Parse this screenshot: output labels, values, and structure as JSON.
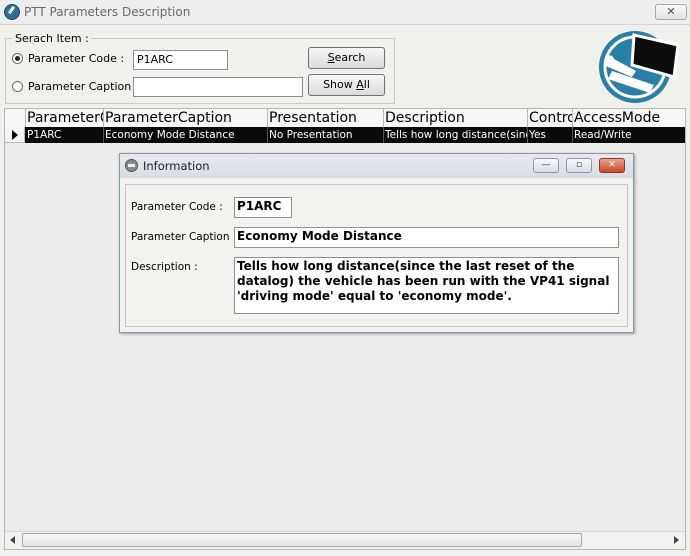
{
  "window": {
    "title": "PTT Parameters Description",
    "close_glyph": "✕"
  },
  "search": {
    "legend": "Serach Item :",
    "param_code_label": "Parameter Code :",
    "param_code_value": "P1ARC",
    "param_caption_label": "Parameter Caption  :",
    "param_caption_value": "",
    "selected_option": "Parameter Code",
    "search_button_hotkey": "S",
    "search_button_rest": "earch",
    "showall_button_prefix": "Show ",
    "showall_button_hotkey": "A",
    "showall_button_rest": "ll"
  },
  "logo": {
    "icon": "wrench-laptop-icon",
    "color": "#2a7fa6"
  },
  "grid": {
    "columns": [
      "ParameterCode",
      "ParameterCaption",
      "Presentation",
      "Description",
      "Control",
      "AccessMode"
    ],
    "rows": [
      [
        "P1ARC",
        "Economy Mode Distance",
        "No Presentation",
        "Tells how long distance(since the last reset of the datalog)",
        "Yes",
        "Read/Write"
      ]
    ],
    "selected_row_color": "#0a0a0a"
  },
  "dialog": {
    "title": "Information",
    "code_label": "Parameter Code :",
    "code_value": "P1ARC",
    "caption_label": "Parameter Caption :",
    "caption_value": "Economy Mode Distance",
    "desc_label": "Description :",
    "desc_value": "Tells how long distance(since the last reset of the datalog) the vehicle has been run with the VP41 signal 'driving mode' equal to 'economy mode'.",
    "minimize_glyph": "—",
    "maximize_glyph": "▫",
    "close_glyph": "✕"
  }
}
